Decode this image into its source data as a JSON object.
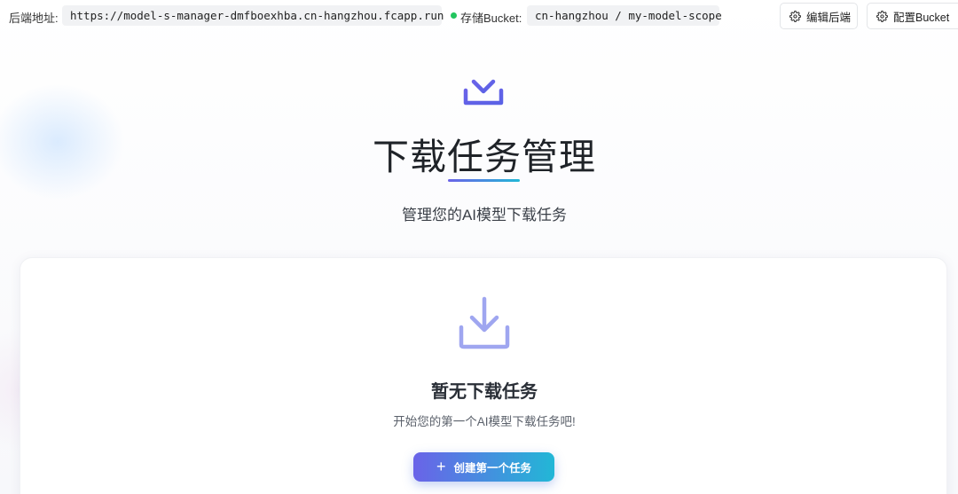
{
  "topbar": {
    "backend_label": "后端地址:",
    "backend_url": "https://model-s-manager-dmfboexhba.cn-hangzhou.fcapp.run",
    "bucket_label": "存储Bucket:",
    "bucket_value": "cn-hangzhou / my-model-scope",
    "edit_backend_label": "编辑后端",
    "config_bucket_label": "配置Bucket"
  },
  "hero": {
    "title": "下载任务管理",
    "subtitle": "管理您的AI模型下载任务"
  },
  "empty_state": {
    "title": "暂无下载任务",
    "subtitle": "开始您的第一个AI模型下载任务吧!",
    "create_button_label": "创建第一个任务"
  },
  "colors": {
    "accent_start": "#6a63e8",
    "accent_end": "#22b7d6",
    "status_online": "#22c55e"
  },
  "icons": {
    "hero": "download-icon",
    "empty": "download-icon",
    "settings": "gear-icon",
    "status": "status-dot-icon",
    "add": "plus-icon"
  }
}
